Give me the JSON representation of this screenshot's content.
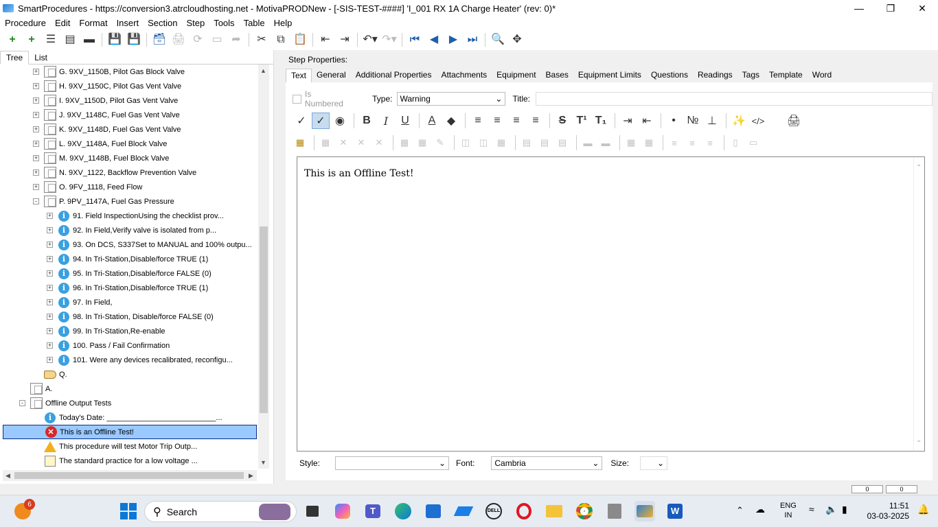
{
  "window": {
    "title": "SmartProcedures - https://conversion3.atrcloudhosting.net - MotivaPRODNew - [-SIS-TEST-####] 'I_001 RX 1A Charge Heater' (rev: 0)*"
  },
  "menu": [
    "Procedure",
    "Edit",
    "Format",
    "Insert",
    "Section",
    "Step",
    "Tools",
    "Table",
    "Help"
  ],
  "left_tabs": [
    "Tree",
    "List"
  ],
  "tree": [
    {
      "text": "G. 9XV_1150B, Pilot Gas Block Valve",
      "icon": "doc",
      "exp": "+",
      "indent": 1
    },
    {
      "text": "H. 9XV_1150C, Pilot Gas Vent Valve",
      "icon": "doc",
      "exp": "+",
      "indent": 1
    },
    {
      "text": "I. 9XV_1150D, Pilot Gas Vent Valve",
      "icon": "doc",
      "exp": "+",
      "indent": 1
    },
    {
      "text": "J. 9XV_1148C, Fuel Gas Vent Valve",
      "icon": "doc",
      "exp": "+",
      "indent": 1
    },
    {
      "text": "K. 9XV_1148D, Fuel Gas Vent Valve",
      "icon": "doc",
      "exp": "+",
      "indent": 1
    },
    {
      "text": "L. 9XV_1148A, Fuel Block Valve",
      "icon": "doc",
      "exp": "+",
      "indent": 1
    },
    {
      "text": "M. 9XV_1148B, Fuel Block Valve",
      "icon": "doc",
      "exp": "+",
      "indent": 1
    },
    {
      "text": "N. 9XV_1122, Backflow Prevention Valve",
      "icon": "doc",
      "exp": "+",
      "indent": 1
    },
    {
      "text": "O. 9FV_1118, Feed Flow",
      "icon": "doc",
      "exp": "+",
      "indent": 1
    },
    {
      "text": "P. 9PV_1147A, Fuel Gas Pressure",
      "icon": "doc",
      "exp": "-",
      "indent": 1
    },
    {
      "text": "91. Field InspectionUsing the checklist prov...",
      "icon": "info",
      "exp": "+",
      "indent": 2
    },
    {
      "text": "92. In Field,Verify valve is isolated from p...",
      "icon": "info",
      "exp": "+",
      "indent": 2
    },
    {
      "text": "93. On DCS, S337Set to MANUAL and 100% outpu...",
      "icon": "info",
      "exp": "+",
      "indent": 2
    },
    {
      "text": "94. In Tri-Station,Disable/force TRUE (1)",
      "icon": "info",
      "exp": "+",
      "indent": 2
    },
    {
      "text": "95. In Tri-Station,Disable/force FALSE (0)",
      "icon": "info",
      "exp": "+",
      "indent": 2
    },
    {
      "text": "96. In Tri-Station,Disable/force TRUE (1)",
      "icon": "info",
      "exp": "+",
      "indent": 2
    },
    {
      "text": "97. In Field,",
      "icon": "info",
      "exp": "+",
      "indent": 2
    },
    {
      "text": "98. In Tri-Station, Disable/force FALSE (0)",
      "icon": "info",
      "exp": "+",
      "indent": 2
    },
    {
      "text": "99. In Tri-Station,Re-enable",
      "icon": "info",
      "exp": "+",
      "indent": 2
    },
    {
      "text": "100. Pass / Fail Confirmation",
      "icon": "info",
      "exp": "+",
      "indent": 2
    },
    {
      "text": "101. Were any devices recalibrated, reconfigu...",
      "icon": "info",
      "exp": "+",
      "indent": 2
    },
    {
      "text": "Q.",
      "icon": "hand",
      "exp": "",
      "indent": 1
    },
    {
      "text": "A.",
      "icon": "doc",
      "exp": "",
      "indent": 0
    },
    {
      "text": "Offline Output Tests",
      "icon": "doc",
      "exp": "-",
      "indent": 0
    },
    {
      "text": "Today's Date: __________________________...",
      "icon": "info",
      "exp": "",
      "indent": 1
    },
    {
      "text": "This is an Offline Test!",
      "icon": "err",
      "exp": "",
      "indent": 1,
      "selected": true
    },
    {
      "text": "This procedure will test Motor Trip Outp...",
      "icon": "warn",
      "exp": "",
      "indent": 1
    },
    {
      "text": "The standard practice for a low voltage ...",
      "icon": "pen",
      "exp": "",
      "indent": 1
    }
  ],
  "step_properties": {
    "header": "Step Properties:",
    "tabs": [
      "Text",
      "General",
      "Additional Properties",
      "Attachments",
      "Equipment",
      "Bases",
      "Equipment Limits",
      "Questions",
      "Readings",
      "Tags",
      "Template",
      "Word"
    ],
    "is_numbered_label": "Is Numbered",
    "type_label": "Type:",
    "type_value": "Warning",
    "title_label": "Title:",
    "title_value": "",
    "editor_text": "This is an Offline Test!",
    "style_label": "Style:",
    "style_value": "",
    "font_label": "Font:",
    "font_value": "Cambria",
    "size_label": "Size:",
    "size_value": ""
  },
  "statusbar": {
    "box1": "0",
    "box2": "0"
  },
  "taskbar": {
    "search_label": "Search",
    "notification_badge": "6",
    "lang_line1": "ENG",
    "lang_line2": "IN",
    "time": "11:51",
    "date": "03-03-2025"
  }
}
